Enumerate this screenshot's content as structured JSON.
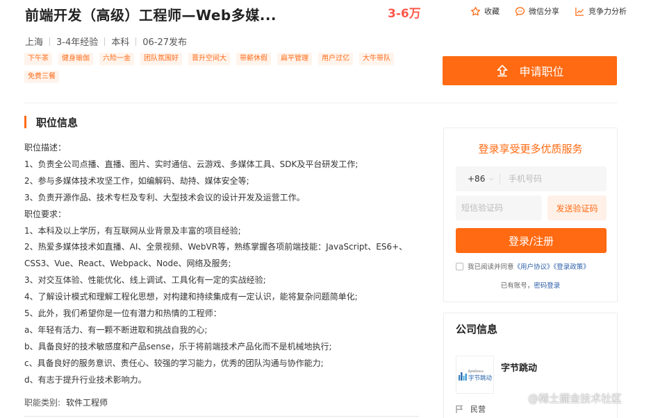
{
  "header": {
    "title": "前端开发（高级）工程师—Web多媒...",
    "salary": "3-6万",
    "actions": {
      "favorite": "收藏",
      "wechat_share": "微信分享",
      "competitiveness": "竞争力分析"
    }
  },
  "meta": {
    "city": "上海",
    "experience": "3-4年经验",
    "education": "本科",
    "published": "06-27发布"
  },
  "tags": [
    "下午茶",
    "健身瑜伽",
    "六险一金",
    "团队氛围好",
    "晋升空间大",
    "带薪休假",
    "扁平管理",
    "用户过亿",
    "大牛带队",
    "免费三餐"
  ],
  "apply_button": "申请职位",
  "job_info": {
    "section_title": "职位信息",
    "lines": [
      "职位描述：",
      "1、负责全公司点播、直播、图片、实时通信、云游戏、多媒体工具、SDK及平台研发工作;",
      "2、参与多媒体技术攻坚工作，如编解码、劫持、媒体安全等;",
      "3、负责开源作品、技术专栏及专利、大型技术会议的设计开发及运营工作。",
      "职位要求：",
      "1、本科及以上学历，有互联网从业背景及丰富的项目经验;",
      "2、热爱多媒体技术如直播、AI、全景视频、WebVR等，熟练掌握各项前端技能：JavaScript、ES6+、",
      "CSS3、Vue、React、Webpack、Node、网络及服务;",
      "3、对交互体验、性能优化、线上调试、工具化有一定的实战经验;",
      "4、了解设计模式和理解工程化思想，对构建和持续集成有一定认识，能将复杂问题简单化;",
      "5、此外，我们希望你是一位有潜力和热情的工程师：",
      "a、年轻有活力、有一颗不断进取和挑战自我的心;",
      "b、具备良好的技术敏感度和产品sense，乐于将前端技术产品化而不是机械地执行;",
      "c、具备良好的服务意识、责任心、较强的学习能力，优秀的团队沟通与协作能力;",
      "d、有志于提升行业技术影响力。"
    ],
    "category_label": "职能类别:",
    "category_value": "软件工程师"
  },
  "login": {
    "title": "登录享受更多优质服务",
    "country_code": "+86",
    "phone_placeholder": "手机号码",
    "code_placeholder": "短信验证码",
    "send_code": "发送验证码",
    "submit": "登录/注册",
    "agree_prefix": "我已阅读并同意",
    "user_agreement": "《用户协议》",
    "privacy_policy": "《登录政策》",
    "has_account": "已有账号，",
    "password_login": "密码登录"
  },
  "company": {
    "section_title": "公司信息",
    "name": "字节跳动",
    "logo_text": "字节跳动",
    "logo_small": "ByteDance",
    "type": "民营"
  },
  "watermark": "@稀土掘金技术社区",
  "colors": {
    "accent": "#ff6a12",
    "salary": "#fe574a",
    "tag_bg": "#fff4ec",
    "link": "#2a5ea8"
  }
}
